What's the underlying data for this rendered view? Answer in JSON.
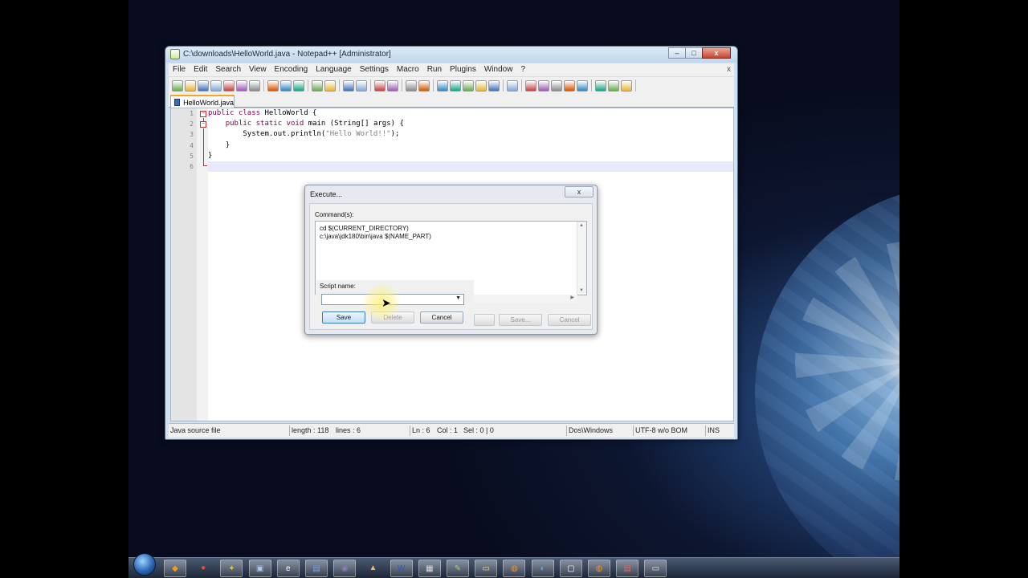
{
  "window": {
    "title": "C:\\downloads\\HelloWorld.java - Notepad++ [Administrator]",
    "caption_buttons": [
      "–",
      "□",
      "x"
    ]
  },
  "menu": {
    "items": [
      "File",
      "Edit",
      "Search",
      "View",
      "Encoding",
      "Language",
      "Settings",
      "Macro",
      "Run",
      "Plugins",
      "Window",
      "?"
    ],
    "close_doc": "x"
  },
  "tab": {
    "label": "HelloWorld.java"
  },
  "editor": {
    "line_numbers": [
      "1",
      "2",
      "3",
      "4",
      "5",
      "6"
    ],
    "lines": [
      {
        "kw1": "public",
        "kw2": "class",
        "rest": " HelloWorld {"
      },
      {
        "indent": "    ",
        "kw1": "public",
        "kw2": "static",
        "kw3": "void",
        "rest": " main (String[] args) {"
      },
      {
        "indent": "        ",
        "pre": "System.out.println(",
        "str": "\"Hello World!!\"",
        "post": ");"
      },
      {
        "indent": "    ",
        "rest": "}"
      },
      {
        "rest": "}"
      },
      {
        "rest": ""
      }
    ]
  },
  "statusbar": {
    "file_type": "Java source file",
    "length": "length : 118",
    "lines": "lines : 6",
    "ln": "Ln : 6",
    "col": "Col : 1",
    "sel": "Sel : 0 | 0",
    "eol": "Dos\\Windows",
    "encoding": "UTF-8 w/o BOM",
    "mode": "INS"
  },
  "execute_dialog": {
    "title": "Execute...",
    "close": "x",
    "commands_label": "Command(s):",
    "commands_text": "cd $(CURRENT_DIRECTORY)\nc:\\java\\jdk180\\bin\\java $(NAME_PART)",
    "save_btn_disabled": "Save...",
    "cancel_btn_back": "Cancel"
  },
  "script_panel": {
    "label": "Script name:",
    "combo_value": "",
    "save": "Save",
    "delete": "Delete",
    "cancel": "Cancel"
  },
  "colors": {
    "keyword": "#7f0055",
    "string": "#808080",
    "fold_marker": "#c03030",
    "tab_accent": "#f5a623",
    "current_line": "#e8e8ff"
  },
  "icons": {
    "toolbar": [
      "new-icon",
      "open-icon",
      "save-icon",
      "save-all-icon",
      "close-icon",
      "close-all-icon",
      "print-icon",
      "cut-icon",
      "copy-icon",
      "paste-icon",
      "undo-icon",
      "redo-icon",
      "find-icon",
      "replace-icon",
      "zoom-in-icon",
      "zoom-out-icon",
      "sync-v-icon",
      "sync-h-icon",
      "wrap-icon",
      "all-chars-icon",
      "indent-guide-icon",
      "doc-map-icon",
      "function-list-icon",
      "folder-workspace-icon",
      "monitor-icon",
      "record-macro-icon",
      "stop-macro-icon",
      "play-macro-icon",
      "run-macro-multiple-icon",
      "save-macro-icon",
      "spellcheck-icon",
      "explorer-icon",
      "settings-icon"
    ],
    "taskbar": [
      "start-orb-icon",
      "app1-icon",
      "app2-icon",
      "app3-icon",
      "explorer-icon",
      "ie-icon",
      "app6-icon",
      "app7-icon",
      "vlc-icon",
      "word-icon",
      "app10-icon",
      "notepadpp-icon",
      "folder-icon",
      "firefox-icon",
      "app14-icon",
      "app15-icon",
      "firefox2-icon",
      "pdf-icon",
      "app18-icon"
    ]
  }
}
